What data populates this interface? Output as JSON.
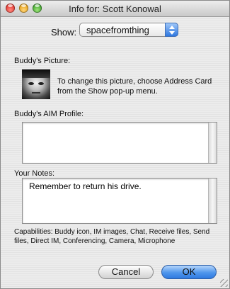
{
  "window": {
    "title": "Info for: Scott Konowal"
  },
  "show": {
    "label": "Show:",
    "selected": "spacefromthing"
  },
  "picture": {
    "heading": "Buddy's Picture:",
    "note": "To change this picture, choose Address Card from the Show pop-up menu."
  },
  "profile": {
    "heading": "Buddy's AIM Profile:",
    "content": ""
  },
  "notes": {
    "heading": "Your Notes:",
    "value": "Remember to return his drive."
  },
  "capabilities": "Capabilities: Buddy icon, IM images, Chat, Receive files, Send files, Direct IM, Conferencing, Camera, Microphone",
  "buttons": {
    "cancel": "Cancel",
    "ok": "OK"
  },
  "colors": {
    "accent": "#4f96ec",
    "close": "#e0322a",
    "minimize": "#e59f16",
    "zoom": "#3da22c"
  }
}
